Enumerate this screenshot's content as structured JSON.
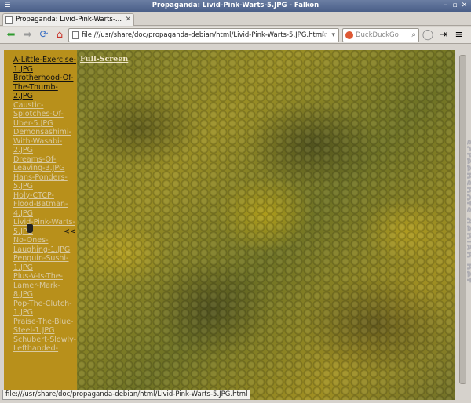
{
  "window": {
    "title": "Propaganda: Livid-Pink-Warts-5.JPG - Falkon"
  },
  "tab": {
    "label": "Propaganda: Livid-Pink-Warts-..."
  },
  "nav": {
    "url": "file:///usr/share/doc/propaganda-debian/html/Livid-Pink-Warts-5.JPG.html",
    "search_placeholder": "DuckDuckGo"
  },
  "sidebar": {
    "items": [
      {
        "label": "A-Little-Exercise-1.JPG",
        "visited": true
      },
      {
        "label": "Brotherhood-Of-The-Thumb-2.JPG",
        "visited": true
      },
      {
        "label": "Caustic-Splotches-Of-Uber-5.JPG",
        "visited": false
      },
      {
        "label": "Demonsashimi-With-Wasabi-2.JPG",
        "visited": false
      },
      {
        "label": "Dreams-Of-Leaving-3.JPG",
        "visited": false
      },
      {
        "label": "Hans-Ponders-5.JPG",
        "visited": false
      },
      {
        "label": "Holy-CTCP-Flood-Batman-4.JPG",
        "visited": false
      },
      {
        "label": "Livid-Pink-Warts-5.JPG",
        "visited": false,
        "current": true
      },
      {
        "label": "No-Ones-Laughing-1.JPG",
        "visited": false
      },
      {
        "label": "Penguin-Sushi-1.JPG",
        "visited": false
      },
      {
        "label": "Plus-V-Is-The-Lamer-Mark-8.JPG",
        "visited": false
      },
      {
        "label": "Pop-The-Clutch-1.JPG",
        "visited": false
      },
      {
        "label": "Praise-The-Blue-Steel-1.JPG",
        "visited": false
      },
      {
        "label": "Schubert-Slowly-Lefthanded-",
        "visited": false
      }
    ],
    "current_marker": "<<"
  },
  "image": {
    "fullscreen_label": "Full-Screen"
  },
  "watermark": "screenshots.debian.net",
  "status": {
    "text": "file:///usr/share/doc/propaganda-debian/html/Livid-Pink-Warts-5.JPG.html"
  }
}
